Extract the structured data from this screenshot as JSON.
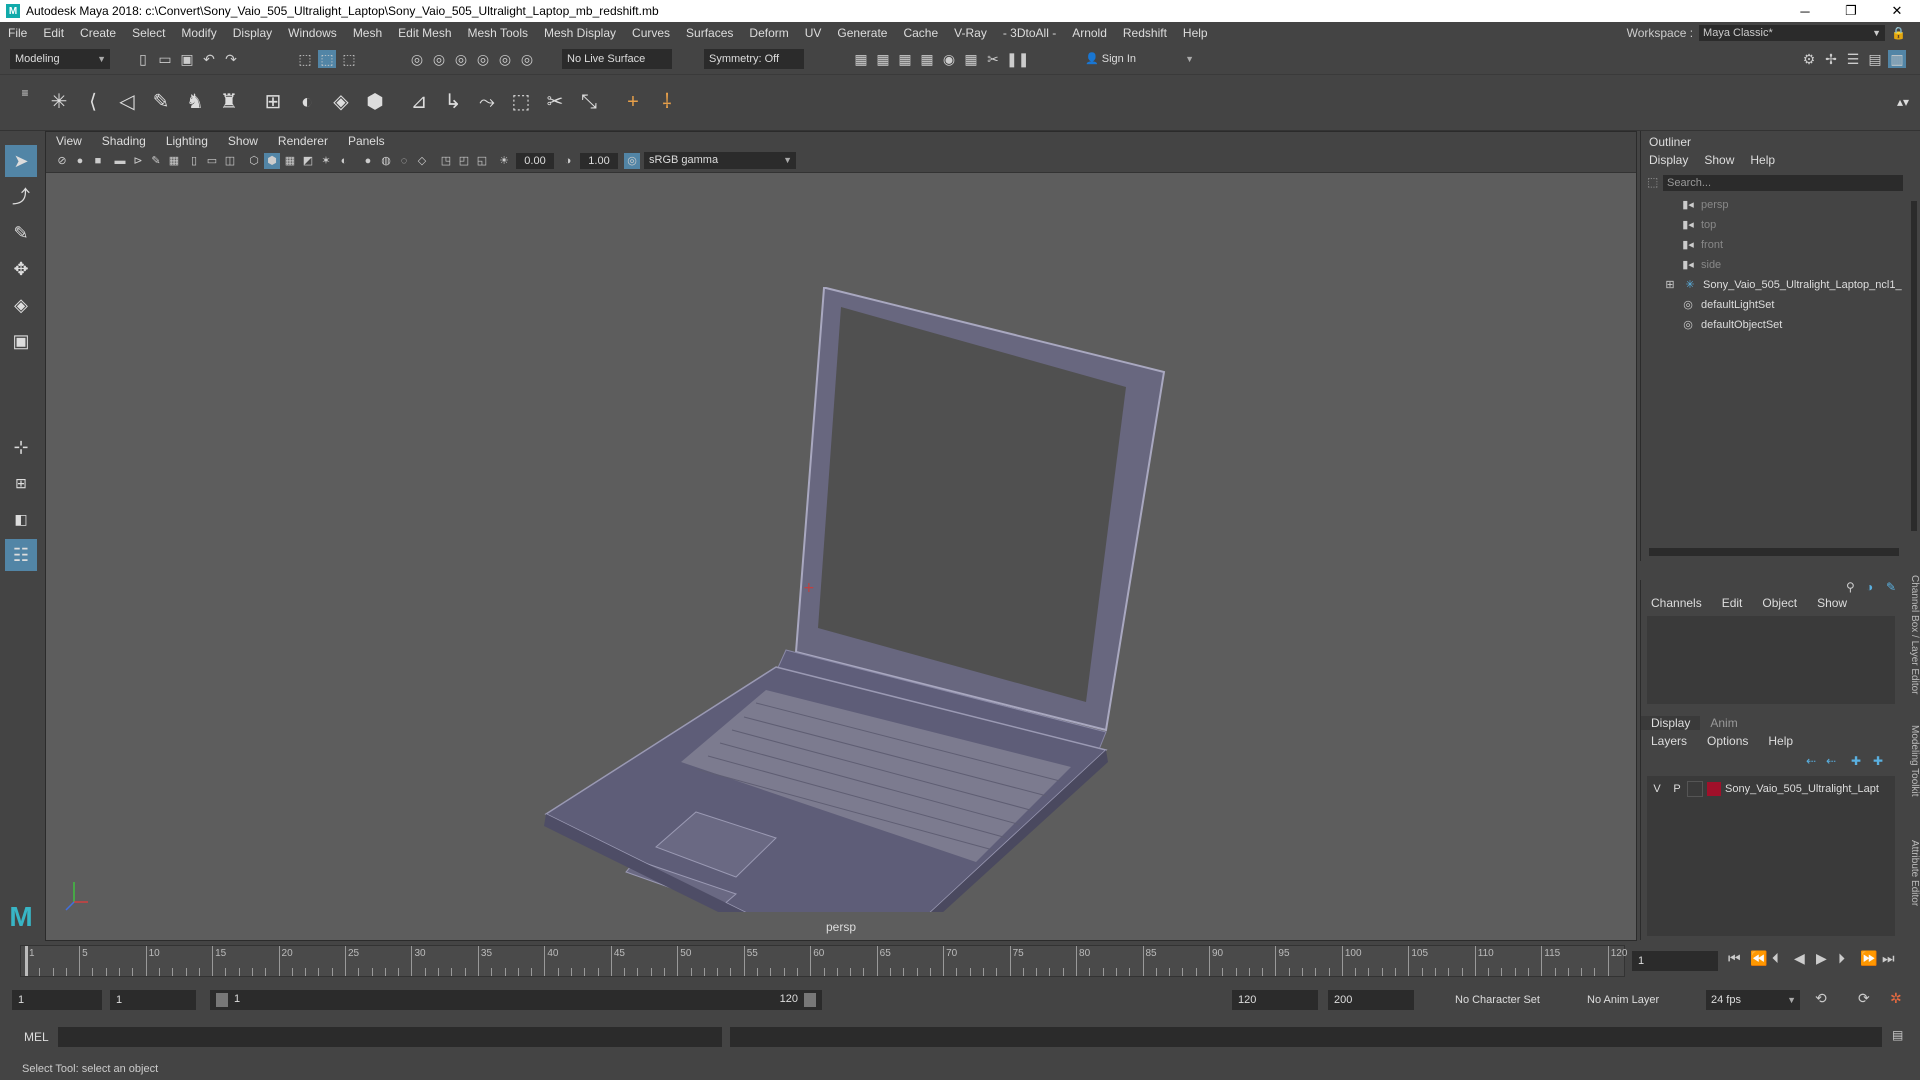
{
  "window": {
    "title": "Autodesk Maya 2018: c:\\Convert\\Sony_Vaio_505_Ultralight_Laptop\\Sony_Vaio_505_Ultralight_Laptop_mb_redshift.mb",
    "minimize": "─",
    "maximize": "❐",
    "close": "✕",
    "logo": "M"
  },
  "menubar": {
    "items": [
      "File",
      "Edit",
      "Create",
      "Select",
      "Modify",
      "Display",
      "Windows",
      "Mesh",
      "Edit Mesh",
      "Mesh Tools",
      "Mesh Display",
      "Curves",
      "Surfaces",
      "Deform",
      "UV",
      "Generate",
      "Cache",
      "V-Ray",
      "- 3DtoAll -",
      "Arnold",
      "Redshift",
      "Help"
    ],
    "workspace_label": "Workspace :",
    "workspace_value": "Maya Classic*"
  },
  "statusline": {
    "menuset": "Modeling",
    "live_surface": "No Live Surface",
    "symmetry": "Symmetry: Off",
    "sign_in": "Sign In"
  },
  "viewport": {
    "menu": [
      "View",
      "Shading",
      "Lighting",
      "Show",
      "Renderer",
      "Panels"
    ],
    "exposure": "0.00",
    "gamma": "1.00",
    "color_space": "sRGB gamma",
    "camera_label": "persp",
    "model_color": "#6b6a88"
  },
  "outliner": {
    "title": "Outliner",
    "menu": [
      "Display",
      "Show",
      "Help"
    ],
    "search_placeholder": "Search...",
    "items": [
      {
        "label": "persp",
        "dim": true
      },
      {
        "label": "top",
        "dim": true
      },
      {
        "label": "front",
        "dim": true
      },
      {
        "label": "side",
        "dim": true
      },
      {
        "label": "Sony_Vaio_505_Ultralight_Laptop_ncl1_",
        "dim": false
      },
      {
        "label": "defaultLightSet",
        "dim": false
      },
      {
        "label": "defaultObjectSet",
        "dim": false
      }
    ]
  },
  "channelbox": {
    "menu": [
      "Channels",
      "Edit",
      "Object",
      "Show"
    ]
  },
  "layereditor": {
    "tabs": [
      "Display",
      "Anim"
    ],
    "menu": [
      "Layers",
      "Options",
      "Help"
    ],
    "layer": {
      "v": "V",
      "p": "P",
      "name": "Sony_Vaio_505_Ultralight_Lapt",
      "color": "#a0102a"
    }
  },
  "side_tabs": [
    "Channel Box / Layer Editor",
    "Modeling Toolkit",
    "Attribute Editor"
  ],
  "timeslider": {
    "ticks": [
      1,
      5,
      10,
      15,
      20,
      25,
      30,
      35,
      40,
      45,
      50,
      55,
      60,
      65,
      70,
      75,
      80,
      85,
      90,
      95,
      100,
      105,
      110,
      115,
      120
    ],
    "current_frame": "1"
  },
  "rangeslider": {
    "start": "1",
    "playback_start": "1",
    "range_start_label": "1",
    "range_end_label": "120",
    "playback_end": "120",
    "end": "200",
    "character_set": "No Character Set",
    "anim_layer": "No Anim Layer",
    "fps": "24 fps"
  },
  "cmdline": {
    "label": "MEL"
  },
  "helpline": {
    "text": "Select Tool: select an object"
  }
}
